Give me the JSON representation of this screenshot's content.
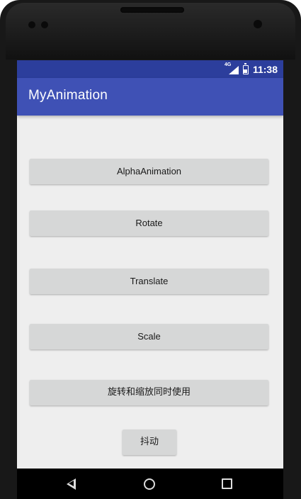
{
  "status_bar": {
    "network_type": "4G",
    "time": "11:38",
    "colors": {
      "background": "#2c3e9c"
    }
  },
  "app_bar": {
    "title": "MyAnimation",
    "colors": {
      "background": "#3f51b5",
      "text": "#ffffff"
    }
  },
  "buttons": [
    {
      "label": "AlphaAnimation"
    },
    {
      "label": "Rotate"
    },
    {
      "label": "Translate"
    },
    {
      "label": "Scale"
    },
    {
      "label": "旋转和缩放同时使用"
    },
    {
      "label": "抖动"
    }
  ],
  "nav_bar": {
    "icons": [
      "back-icon",
      "home-icon",
      "recent-apps-icon"
    ]
  }
}
